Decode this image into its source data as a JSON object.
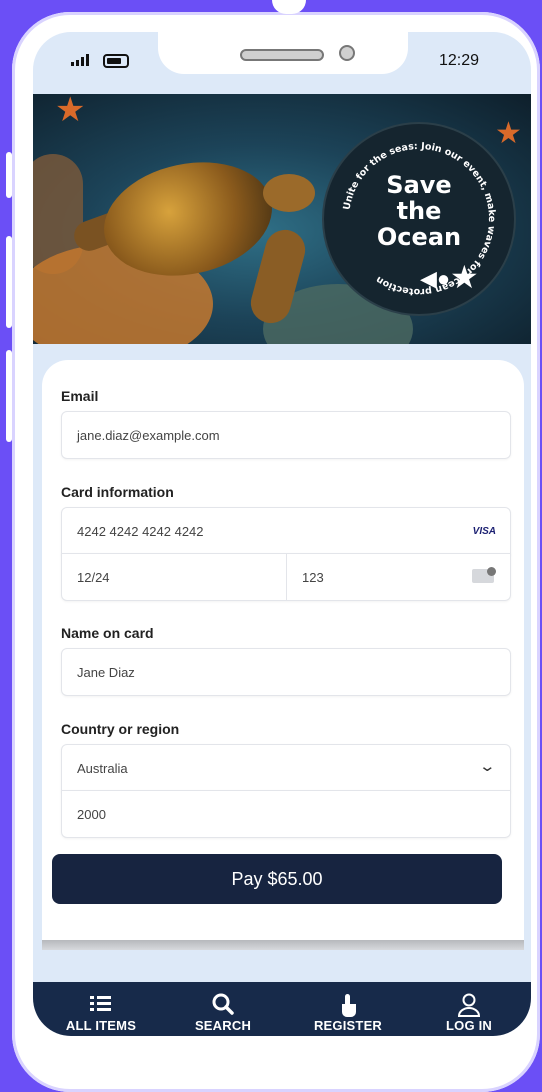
{
  "status_bar": {
    "time": "12:29"
  },
  "hero": {
    "badge_title_line1": "Save",
    "badge_title_line2": "the",
    "badge_title_line3": "Ocean",
    "badge_ring_text": "Unite for the seas: Join our event, make waves for ocean protection"
  },
  "form": {
    "email_label": "Email",
    "email_value": "jane.diaz@example.com",
    "card_label": "Card information",
    "card_number": "4242 4242 4242 4242",
    "card_brand": "VISA",
    "card_expiry": "12/24",
    "card_cvc": "123",
    "name_label": "Name on card",
    "name_value": "Jane Diaz",
    "country_label": "Country or region",
    "country_value": "Australia",
    "postcode_value": "2000",
    "pay_button": "Pay $65.00"
  },
  "nav": {
    "items": [
      {
        "label": "ALL ITEMS",
        "icon": "list-icon"
      },
      {
        "label": "SEARCH",
        "icon": "search-icon"
      },
      {
        "label": "REGISTER",
        "icon": "hand-pointer-icon"
      },
      {
        "label": "LOG IN",
        "icon": "user-icon"
      }
    ]
  },
  "colors": {
    "background": "#6b4ff6",
    "screen": "#dde9f8",
    "pay_button": "#172440",
    "nav_bar": "#172a4a"
  }
}
